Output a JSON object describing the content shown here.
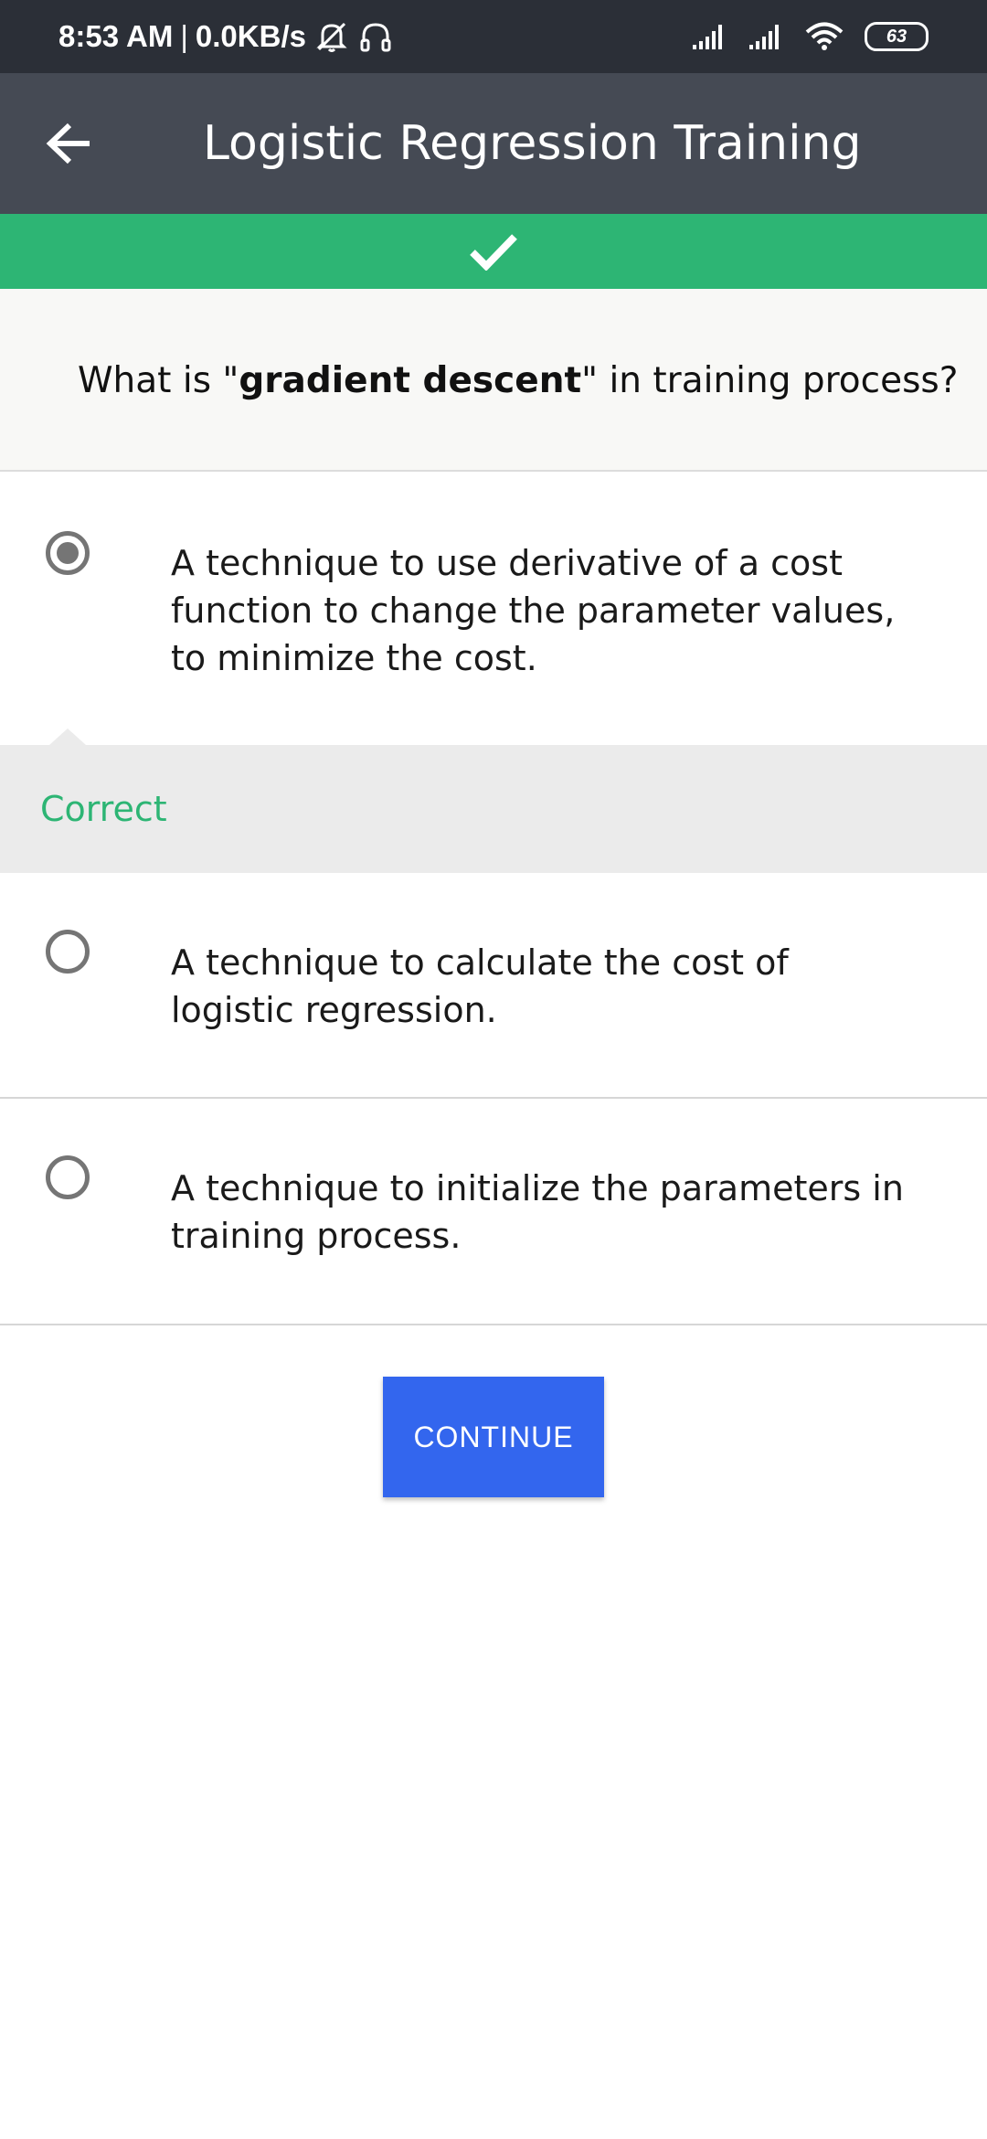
{
  "status_bar": {
    "time": "8:53 AM",
    "separator": "|",
    "net_speed": "0.0KB/s",
    "battery": "63",
    "icons": [
      "mute-icon",
      "headset-icon",
      "signal-icon",
      "signal-icon",
      "wifi-icon",
      "battery-icon"
    ]
  },
  "app_bar": {
    "title": "Logistic Regression Training",
    "back_icon": "back-arrow-icon"
  },
  "result": {
    "icon": "checkmark-icon",
    "color": "#2db574"
  },
  "question": {
    "prefix": "What is \"",
    "term": "gradient descent",
    "suffix": "\" in training process?"
  },
  "options": [
    {
      "text": "A technique to use derivative of a cost function to change the parameter values, to minimize the cost.",
      "selected": true
    },
    {
      "text": "A technique to calculate the cost of logistic regression.",
      "selected": false
    },
    {
      "text": "A technique to initialize the parameters in training process.",
      "selected": false
    }
  ],
  "feedback": {
    "label": "Correct"
  },
  "continue_button": {
    "label": "CONTINUE",
    "color": "#3366ee"
  }
}
